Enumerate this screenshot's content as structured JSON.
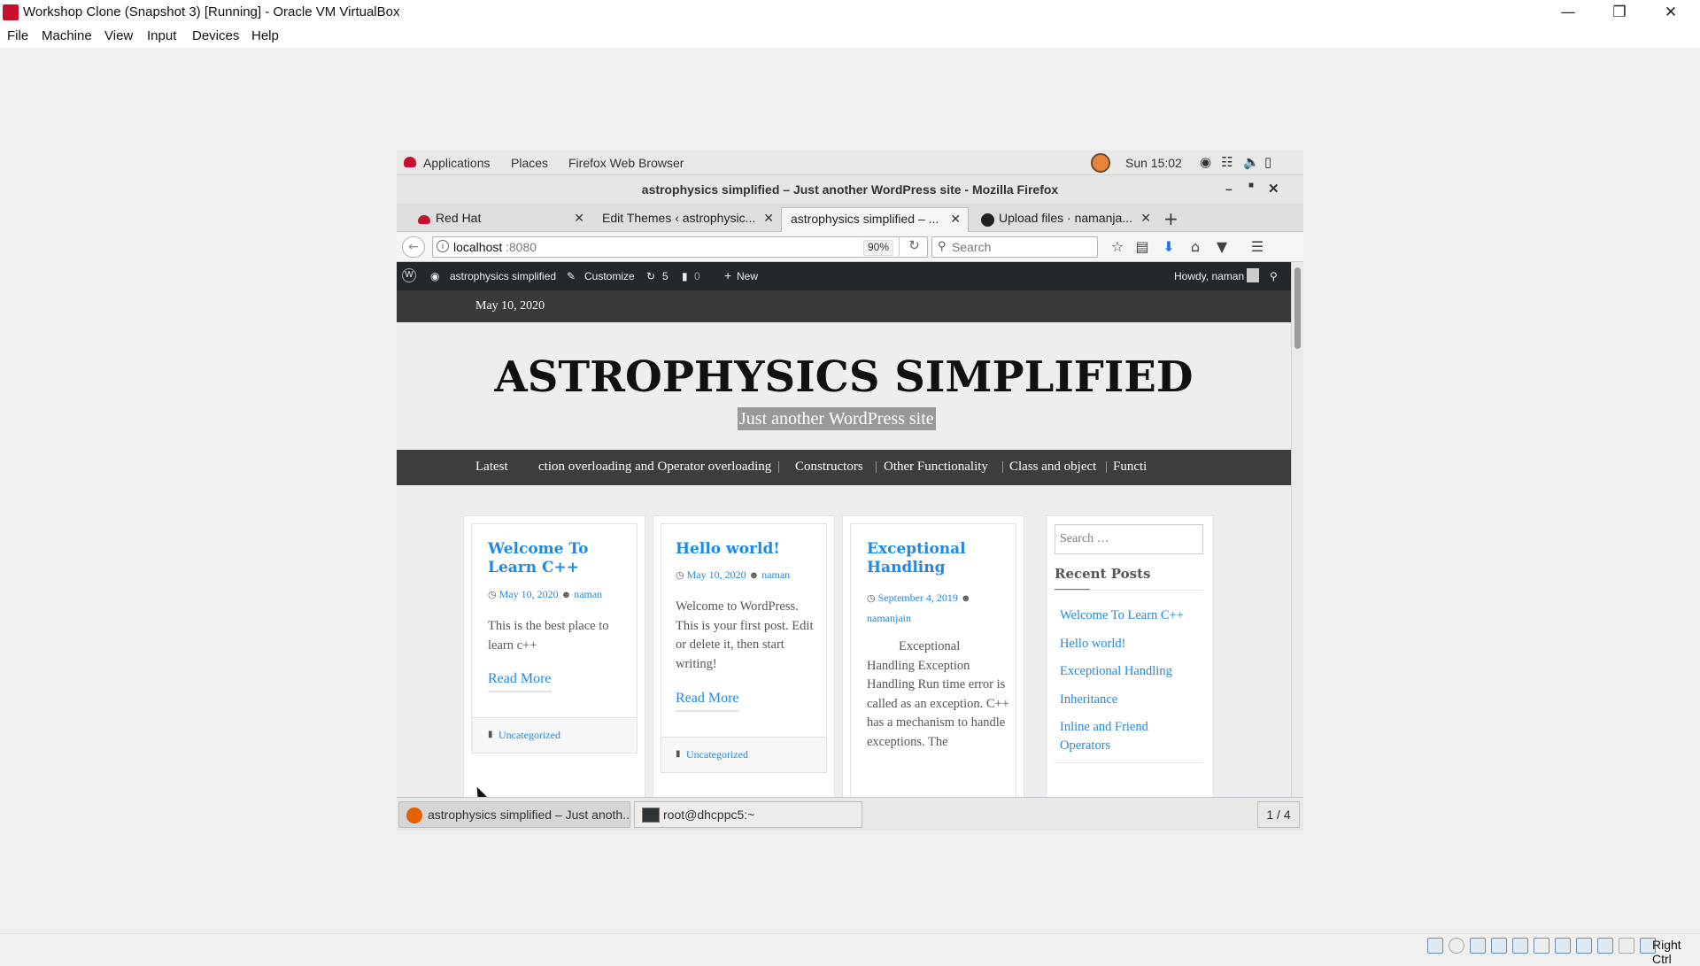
{
  "host": {
    "window_title": "Workshop Clone (Snapshot 3) [Running] - Oracle VM VirtualBox",
    "menu": [
      "File",
      "Machine",
      "View",
      "Input",
      "Devices",
      "Help"
    ],
    "status_right": "Right Ctrl",
    "brand_color": "#c8102e"
  },
  "gnome": {
    "applications": "Applications",
    "places": "Places",
    "active_app": "Firefox Web Browser",
    "clock": "Sun 15:02"
  },
  "firefox": {
    "window_title": "astrophysics simplified – Just another WordPress site - Mozilla Firefox",
    "tabs": [
      {
        "label": "Red Hat",
        "icon": "redhat-icon"
      },
      {
        "label": "Edit Themes ‹ astrophysic...",
        "icon": ""
      },
      {
        "label": "astrophysics simplified – ...",
        "icon": ""
      },
      {
        "label": "Upload files · namanja...",
        "icon": "github-icon"
      }
    ],
    "url_host": "localhost",
    "url_port": ":8080",
    "zoom": "90%",
    "search_placeholder": "Search"
  },
  "wp_admin": {
    "site_name": "astrophysics simplified",
    "customize": "Customize",
    "updates": "5",
    "comments": "0",
    "new": "New",
    "howdy": "Howdy, naman"
  },
  "site": {
    "date": "May 10, 2020",
    "title": "ASTROPHYSICS SIMPLIFIED",
    "description": "Just another WordPress site",
    "nav_latest": "Latest",
    "nav_items": [
      "ction overloading and Operator overloading",
      "Constructors",
      "Other Functionality",
      "Class and object",
      "Functi"
    ]
  },
  "posts": [
    {
      "title": "Welcome To Learn C++",
      "date": "May 10, 2020",
      "author": "naman",
      "excerpt": "This is the best place to learn c++",
      "read_more": "Read More",
      "category": "Uncategorized"
    },
    {
      "title": "Hello world!",
      "date": "May 10, 2020",
      "author": "naman",
      "excerpt": "Welcome to WordPress. This is your first post. Edit or delete it, then start writing!",
      "read_more": "Read More",
      "category": "Uncategorized"
    },
    {
      "title": "Exceptional Handling",
      "date": "September 4, 2019",
      "author": "namanjain",
      "excerpt": "Exceptional Handling Exception Handling Run time error is called as an exception. C++ has a mechanism to handle exceptions. The"
    }
  ],
  "sidebar": {
    "search_placeholder": "Search …",
    "recent_heading": "Recent Posts",
    "recent": [
      "Welcome To Learn C++",
      "Hello world!",
      "Exceptional Handling",
      "Inheritance",
      "Inline and Friend Operators"
    ]
  },
  "taskbar": {
    "firefox_task": "astrophysics simplified – Just anoth...",
    "terminal_task": "root@dhcppc5:~",
    "workspace": "1 / 4"
  }
}
